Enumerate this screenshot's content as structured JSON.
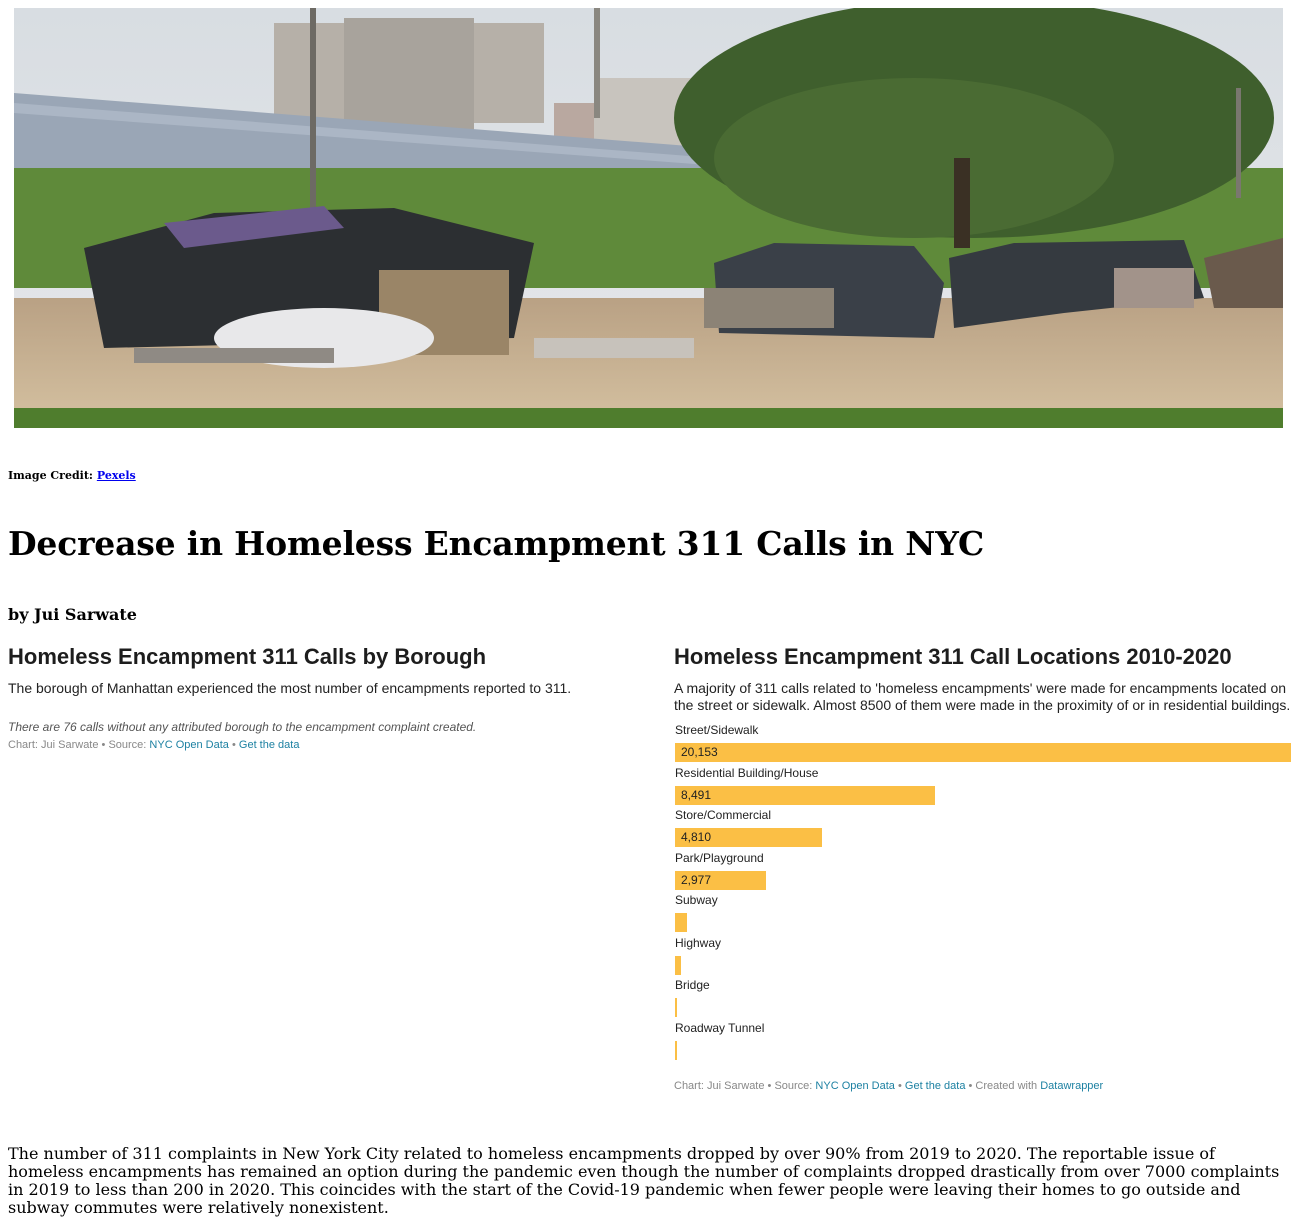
{
  "image_credit": {
    "label": "Image Credit:",
    "link_text": "Pexels"
  },
  "article": {
    "title": "Decrease in Homeless Encampment 311 Calls in NYC",
    "byline": "by Jui Sarwate",
    "body": "The number of 311 complaints in New York City related to homeless encampments dropped by over 90% from 2019 to 2020. The reportable issue of homeless encampments has remained an option during the pandemic even though the number of complaints dropped drastically from over 7000 complaints in 2019 to less than 200 in 2020. This coincides with the start of the Covid-19 pandemic when fewer people were leaving their homes to go outside and subway commutes were relatively nonexistent."
  },
  "borough_chart": {
    "title": "Homeless Encampment 311 Calls by Borough",
    "description": "The borough of Manhattan experienced the most number of encampments reported to 311.",
    "note": "There are 76 calls without any attributed borough to the encampment complaint created.",
    "source": {
      "prefix": "Chart: Jui Sarwate • Source:",
      "source_link": "NYC Open Data",
      "sep": "•",
      "data_link": "Get the data"
    }
  },
  "location_chart": {
    "title": "Homeless Encampment 311 Call Locations 2010-2020",
    "description": "A majority of 311 calls related to 'homeless encampments' were made for encampments located on the street or sidewalk. Almost 8500 of them were made in the proximity of or in residential buildings.",
    "source": {
      "prefix": "Chart: Jui Sarwate • Source:",
      "source_link": "NYC Open Data",
      "sep1": "•",
      "data_link": "Get the data",
      "sep2": "• Created with",
      "tool_link": "Datawrapper"
    }
  },
  "chart_data": {
    "type": "bar",
    "title": "Homeless Encampment 311 Call Locations 2010-2020",
    "categories": [
      "Street/Sidewalk",
      "Residential Building/House",
      "Store/Commercial",
      "Park/Playground",
      "Subway",
      "Highway",
      "Bridge",
      "Roadway Tunnel"
    ],
    "values": [
      20153,
      8491,
      4810,
      2977,
      390,
      200,
      60,
      30
    ],
    "value_labels": [
      "20,153",
      "8,491",
      "4,810",
      "2,977",
      "",
      "",
      "",
      ""
    ],
    "orientation": "horizontal",
    "bar_color": "#fbbf45",
    "xlim": [
      0,
      20153
    ]
  }
}
